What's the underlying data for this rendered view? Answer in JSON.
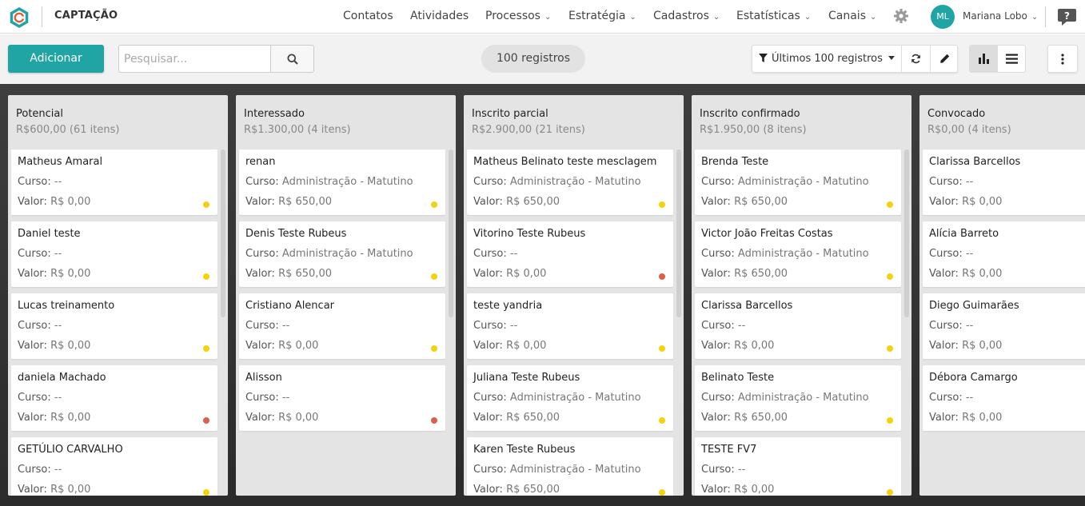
{
  "header": {
    "module_title": "CAPTAÇÃO",
    "nav": [
      "Contatos",
      "Atividades",
      "Processos",
      "Estratégia",
      "Cadastros",
      "Estatísticas",
      "Canais"
    ],
    "user_initials": "ML",
    "user_name": "Mariana Lobo",
    "accent_color": "#21a4a4"
  },
  "toolbar": {
    "add_label": "Adicionar",
    "search_placeholder": "Pesquisar...",
    "record_count": "100 registros",
    "filter_label": "Últimos 100 registros"
  },
  "columns": [
    {
      "title": "Potencial",
      "summary": "R$600,00 (61 itens)",
      "cards": [
        {
          "name": "Matheus Amaral",
          "curso": "--",
          "valor": "R$ 0,00",
          "status": "yellow"
        },
        {
          "name": "Daniel teste",
          "curso": "--",
          "valor": "R$ 0,00",
          "status": "yellow"
        },
        {
          "name": "Lucas treinamento",
          "curso": "--",
          "valor": "R$ 0,00",
          "status": "yellow"
        },
        {
          "name": "daniela Machado",
          "curso": "--",
          "valor": "R$ 0,00",
          "status": "red"
        },
        {
          "name": "GETÚLIO CARVALHO",
          "curso": "--",
          "valor": "R$ 0,00",
          "status": "yellow"
        }
      ]
    },
    {
      "title": "Interessado",
      "summary": "R$1.300,00 (4 itens)",
      "cards": [
        {
          "name": "renan",
          "curso": "Administração - Matutino",
          "valor": "R$ 650,00",
          "status": "yellow"
        },
        {
          "name": "Denis Teste Rubeus",
          "curso": "Administração - Matutino",
          "valor": "R$ 650,00",
          "status": "yellow"
        },
        {
          "name": "Cristiano Alencar",
          "curso": "--",
          "valor": "R$ 0,00",
          "status": "yellow"
        },
        {
          "name": "Alisson",
          "curso": "--",
          "valor": "R$ 0,00",
          "status": "red"
        }
      ]
    },
    {
      "title": "Inscrito parcial",
      "summary": "R$2.900,00 (21 itens)",
      "cards": [
        {
          "name": "Matheus Belinato teste mesclagem",
          "curso": "Administração - Matutino",
          "valor": "R$ 650,00",
          "status": "yellow"
        },
        {
          "name": "Vitorino Teste Rubeus",
          "curso": "--",
          "valor": "R$ 0,00",
          "status": "red"
        },
        {
          "name": "teste yandria",
          "curso": "--",
          "valor": "R$ 0,00",
          "status": "yellow"
        },
        {
          "name": "Juliana Teste Rubeus",
          "curso": "Administração - Matutino",
          "valor": "R$ 650,00",
          "status": "yellow"
        },
        {
          "name": "Karen Teste Rubeus",
          "curso": "Administração - Matutino",
          "valor": "R$ 650,00",
          "status": "yellow"
        }
      ]
    },
    {
      "title": "Inscrito confirmado",
      "summary": "R$1.950,00 (8 itens)",
      "cards": [
        {
          "name": "Brenda Teste",
          "curso": "Administração - Matutino",
          "valor": "R$ 650,00",
          "status": "yellow"
        },
        {
          "name": "Victor João Freitas Costas",
          "curso": "Administração - Matutino",
          "valor": "R$ 650,00",
          "status": "yellow"
        },
        {
          "name": "Clarissa Barcellos",
          "curso": "--",
          "valor": "R$ 0,00",
          "status": "yellow"
        },
        {
          "name": "Belinato Teste",
          "curso": "Administração - Matutino",
          "valor": "R$ 650,00",
          "status": "yellow"
        },
        {
          "name": "TESTE FV7",
          "curso": "--",
          "valor": "R$ 0,00",
          "status": "yellow"
        }
      ]
    },
    {
      "title": "Convocado",
      "summary": "R$0,00 (4 itens)",
      "cards": [
        {
          "name": "Clarissa Barcellos",
          "curso": "--",
          "valor": "R$ 0,00",
          "status": ""
        },
        {
          "name": "Alícia Barreto",
          "curso": "--",
          "valor": "R$ 0,00",
          "status": ""
        },
        {
          "name": "Diego Guimarães",
          "curso": "--",
          "valor": "R$ 0,00",
          "status": ""
        },
        {
          "name": "Débora Camargo",
          "curso": "--",
          "valor": "R$ 0,00",
          "status": ""
        }
      ]
    }
  ],
  "labels": {
    "curso": "Curso:",
    "valor": "Valor:"
  },
  "status_colors": {
    "yellow": "#f2d30f",
    "red": "#d9604a"
  }
}
